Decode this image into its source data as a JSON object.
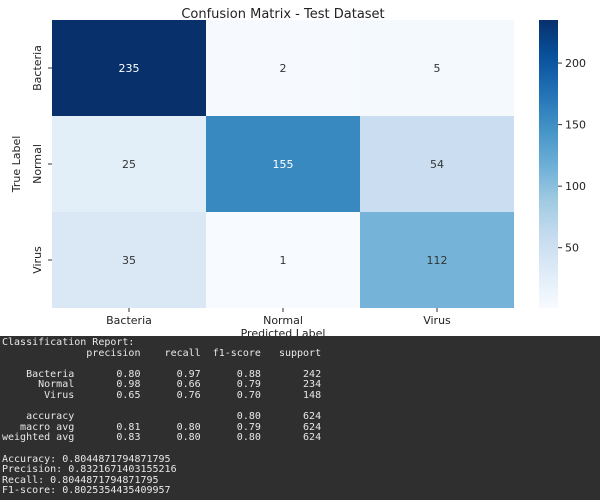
{
  "chart_data": {
    "type": "heatmap",
    "title": "Confusion Matrix - Test Dataset",
    "xlabel": "Predicted Label",
    "ylabel": "True Label",
    "x_categories": [
      "Bacteria",
      "Normal",
      "Virus"
    ],
    "y_categories": [
      "Bacteria",
      "Normal",
      "Virus"
    ],
    "values": [
      [
        235,
        2,
        5
      ],
      [
        25,
        155,
        54
      ],
      [
        35,
        1,
        112
      ]
    ],
    "colormap": "Blues",
    "colorbar_ticks": [
      50,
      100,
      150,
      200
    ],
    "colorbar_range": [
      1,
      235
    ]
  },
  "report": {
    "lines": [
      "Classification Report:",
      "              precision    recall  f1-score   support",
      "",
      "    Bacteria       0.80      0.97      0.88       242",
      "      Normal       0.98      0.66      0.79       234",
      "       Virus       0.65      0.76      0.70       148",
      "",
      "    accuracy                           0.80       624",
      "   macro avg       0.81      0.80      0.79       624",
      "weighted avg       0.83      0.80      0.80       624",
      "",
      "Accuracy: 0.8044871794871795",
      "Precision: 0.8321671403155216",
      "Recall: 0.8044871794871795",
      "F1-score: 0.8025354435409957"
    ]
  }
}
